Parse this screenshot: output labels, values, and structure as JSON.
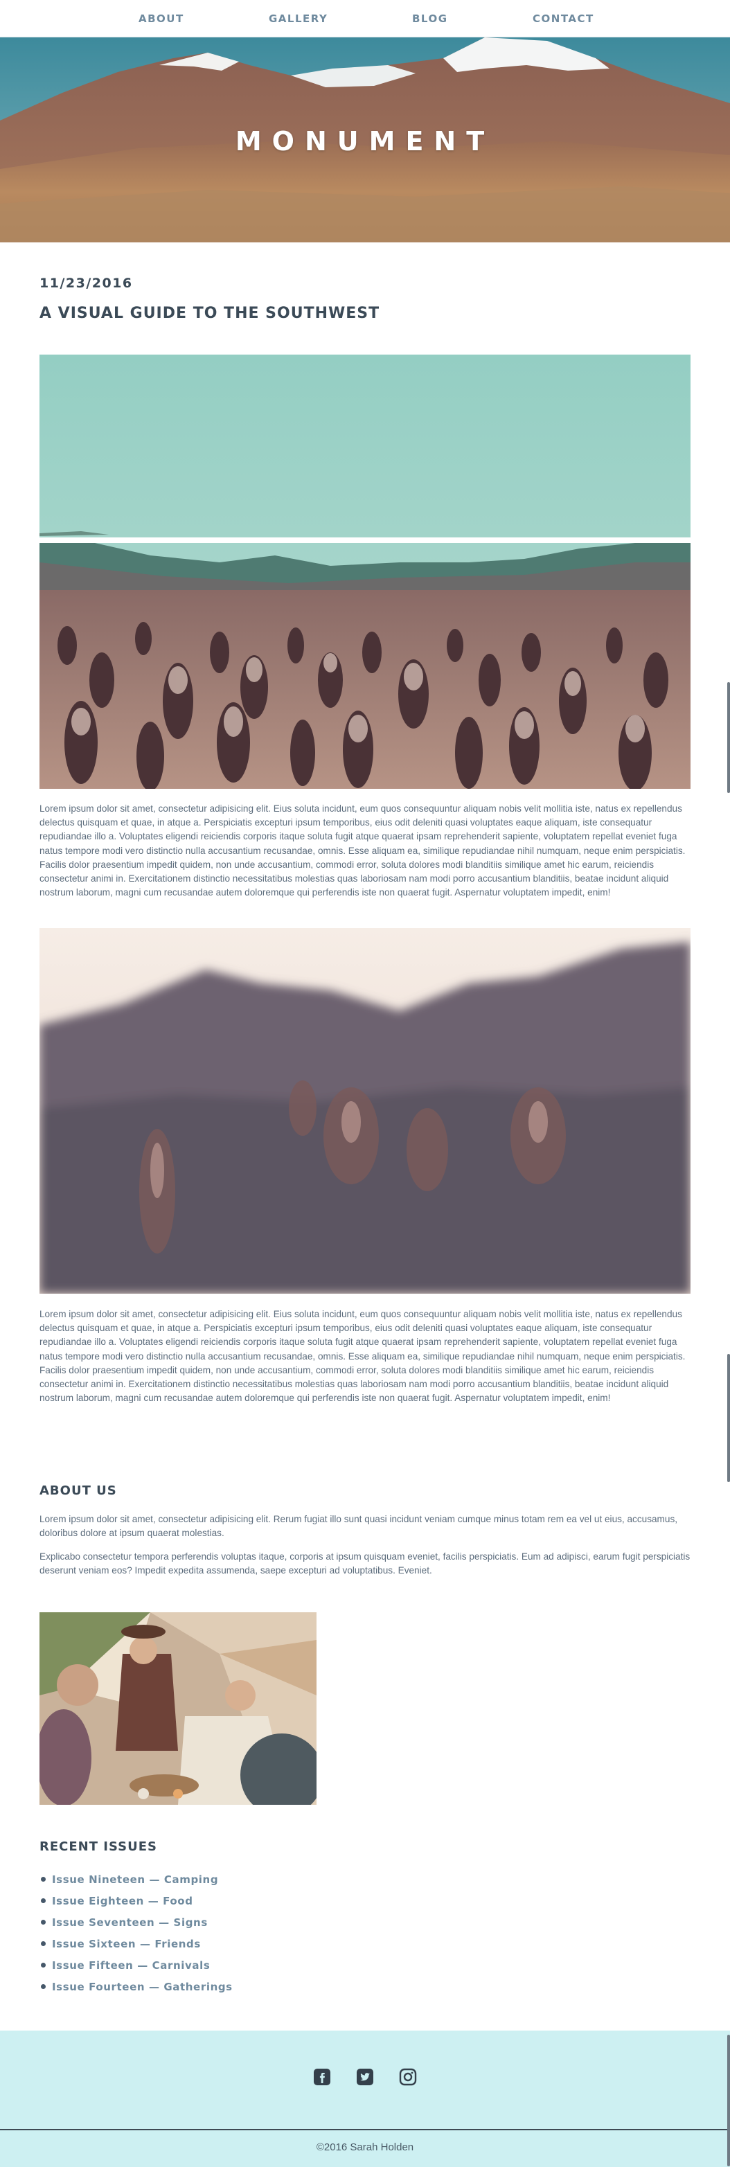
{
  "nav": {
    "items": [
      {
        "label": "ABOUT"
      },
      {
        "label": "GALLERY"
      },
      {
        "label": "BLOG"
      },
      {
        "label": "CONTACT"
      }
    ]
  },
  "hero": {
    "title": "MONUMENT"
  },
  "post": {
    "date": "11/23/2016",
    "title": "A VISUAL GUIDE TO THE SOUTHWEST",
    "paragraph1": "Lorem ipsum dolor sit amet, consectetur adipisicing elit. Eius soluta incidunt, eum quos consequuntur aliquam nobis velit mollitia iste, natus ex repellendus delectus quisquam et quae, in atque a. Perspiciatis excepturi ipsum temporibus, eius odit deleniti quasi voluptates eaque aliquam, iste consequatur repudiandae illo a. Voluptates eligendi reiciendis corporis itaque soluta fugit atque quaerat ipsam reprehenderit sapiente, voluptatem repellat eveniet fuga natus tempore modi vero distinctio nulla accusantium recusandae, omnis. Esse aliquam ea, similique repudiandae nihil numquam, neque enim perspiciatis. Facilis dolor praesentium impedit quidem, non unde accusantium, commodi error, soluta dolores modi blanditiis similique amet hic earum, reiciendis consectetur animi in. Exercitationem distinctio necessitatibus molestias quas laboriosam nam modi porro accusantium blanditiis, beatae incidunt aliquid nostrum laborum, magni cum recusandae autem doloremque qui perferendis iste non quaerat fugit. Aspernatur voluptatem impedit, enim!",
    "paragraph2": "Lorem ipsum dolor sit amet, consectetur adipisicing elit. Eius soluta incidunt, eum quos consequuntur aliquam nobis velit mollitia iste, natus ex repellendus delectus quisquam et quae, in atque a. Perspiciatis excepturi ipsum temporibus, eius odit deleniti quasi voluptates eaque aliquam, iste consequatur repudiandae illo a. Voluptates eligendi reiciendis corporis itaque soluta fugit atque quaerat ipsam reprehenderit sapiente, voluptatem repellat eveniet fuga natus tempore modi vero distinctio nulla accusantium recusandae, omnis. Esse aliquam ea, similique repudiandae nihil numquam, neque enim perspiciatis. Facilis dolor praesentium impedit quidem, non unde accusantium, commodi error, soluta dolores modi blanditiis similique amet hic earum, reiciendis consectetur animi in. Exercitationem distinctio necessitatibus molestias quas laboriosam nam modi porro accusantium blanditiis, beatae incidunt aliquid nostrum laborum, magni cum recusandae autem doloremque qui perferendis iste non quaerat fugit. Aspernatur voluptatem impedit, enim!"
  },
  "about": {
    "heading": "ABOUT US",
    "paragraph1": "Lorem ipsum dolor sit amet, consectetur adipisicing elit. Rerum fugiat illo sunt quasi incidunt veniam cumque minus totam rem ea vel ut eius, accusamus, doloribus dolore at ipsum quaerat molestias.",
    "paragraph2": "Explicabo consectetur tempora perferendis voluptas itaque, corporis at ipsum quisquam eveniet, facilis perspiciatis. Eum ad adipisci, earum fugit perspiciatis deserunt veniam eos? Impedit expedita assumenda, saepe excepturi ad voluptatibus. Eveniet."
  },
  "recent": {
    "heading": "RECENT ISSUES",
    "items": [
      {
        "label": "Issue Nineteen — Camping"
      },
      {
        "label": "Issue Eighteen — Food"
      },
      {
        "label": "Issue Seventeen — Signs"
      },
      {
        "label": "Issue Sixteen — Friends"
      },
      {
        "label": "Issue Fifteen — Carnivals"
      },
      {
        "label": "Issue Fourteen — Gatherings"
      }
    ]
  },
  "footer": {
    "social_icons": [
      "facebook-icon",
      "twitter-icon",
      "instagram-icon"
    ],
    "copyright": "©2016 Sarah Holden"
  },
  "colors": {
    "nav_link": "#6f8a9e",
    "heading": "#3b4a57",
    "body_text": "#5d6d7d",
    "footer_bg": "#cdf0f2"
  }
}
